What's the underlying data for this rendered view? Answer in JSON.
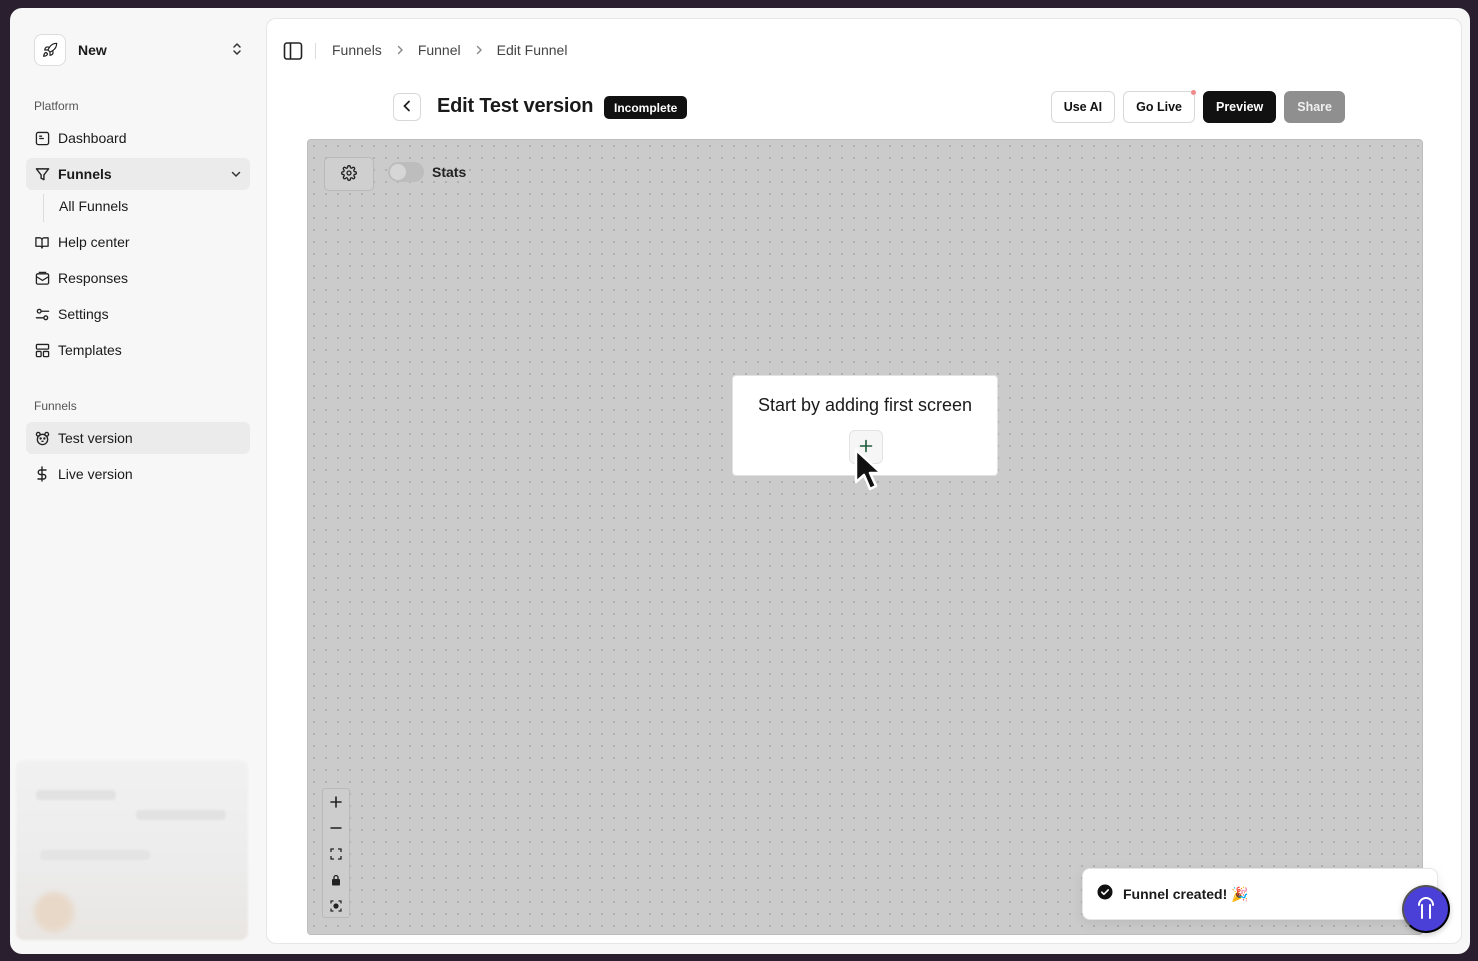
{
  "workspace": {
    "name": "New",
    "icon": "rocket-icon"
  },
  "sidebar": {
    "platform_label": "Platform",
    "items": [
      {
        "label": "Dashboard",
        "icon": "dashboard-icon"
      },
      {
        "label": "Funnels",
        "icon": "funnel-icon"
      },
      {
        "label": "Help center",
        "icon": "book-icon"
      },
      {
        "label": "Responses",
        "icon": "inbox-icon"
      },
      {
        "label": "Settings",
        "icon": "sliders-icon"
      },
      {
        "label": "Templates",
        "icon": "layout-icon"
      }
    ],
    "funnels_subitems": [
      {
        "label": "All Funnels"
      }
    ],
    "funnels_label": "Funnels",
    "versions": [
      {
        "label": "Test version",
        "icon": "bear-icon",
        "active": true
      },
      {
        "label": "Live version",
        "icon": "dollar-icon",
        "active": false
      }
    ]
  },
  "breadcrumb": [
    "Funnels",
    "Funnel",
    "Edit Funnel"
  ],
  "header": {
    "title": "Edit Test version",
    "status": "Incomplete",
    "actions": {
      "use_ai": "Use AI",
      "go_live": "Go Live",
      "preview": "Preview",
      "share": "Share"
    }
  },
  "canvas": {
    "stats_label": "Stats",
    "stats_enabled": false,
    "empty_prompt": "Start by adding first screen"
  },
  "toast": {
    "message": "Funnel created! 🎉"
  },
  "colors": {
    "accent": "#4a3fd6",
    "badge_bg": "#111111",
    "canvas_bg": "#cbcbcb"
  }
}
